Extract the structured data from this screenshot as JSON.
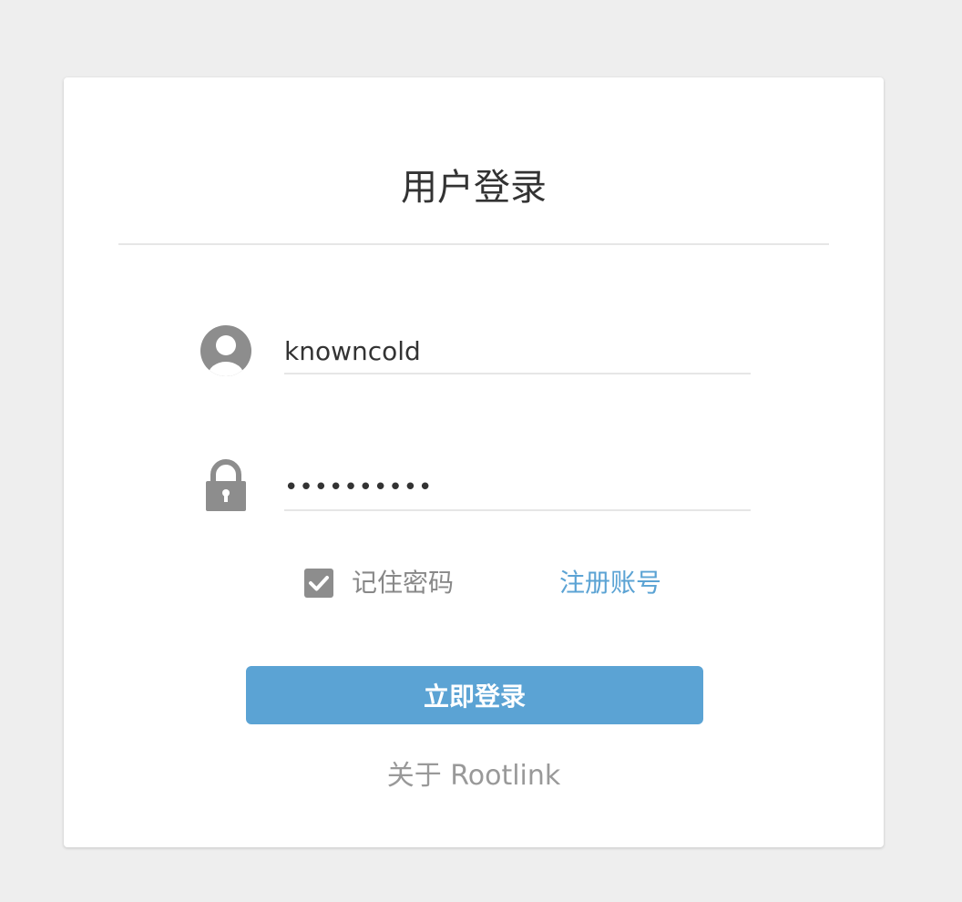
{
  "login": {
    "title": "用户登录",
    "username": {
      "value": "knowncold",
      "icon": "user-avatar-icon"
    },
    "password": {
      "value": "••••••••••",
      "icon": "lock-icon"
    },
    "remember": {
      "label": "记住密码",
      "checked": true
    },
    "register_label": "注册账号",
    "submit_label": "立即登录",
    "about_label": "关于 Rootlink"
  },
  "colors": {
    "background": "#eeeeee",
    "card": "#ffffff",
    "accent": "#5ba3d4",
    "icon_gray": "#8d8d8d",
    "text_dark": "#333333",
    "text_muted": "#888888"
  }
}
